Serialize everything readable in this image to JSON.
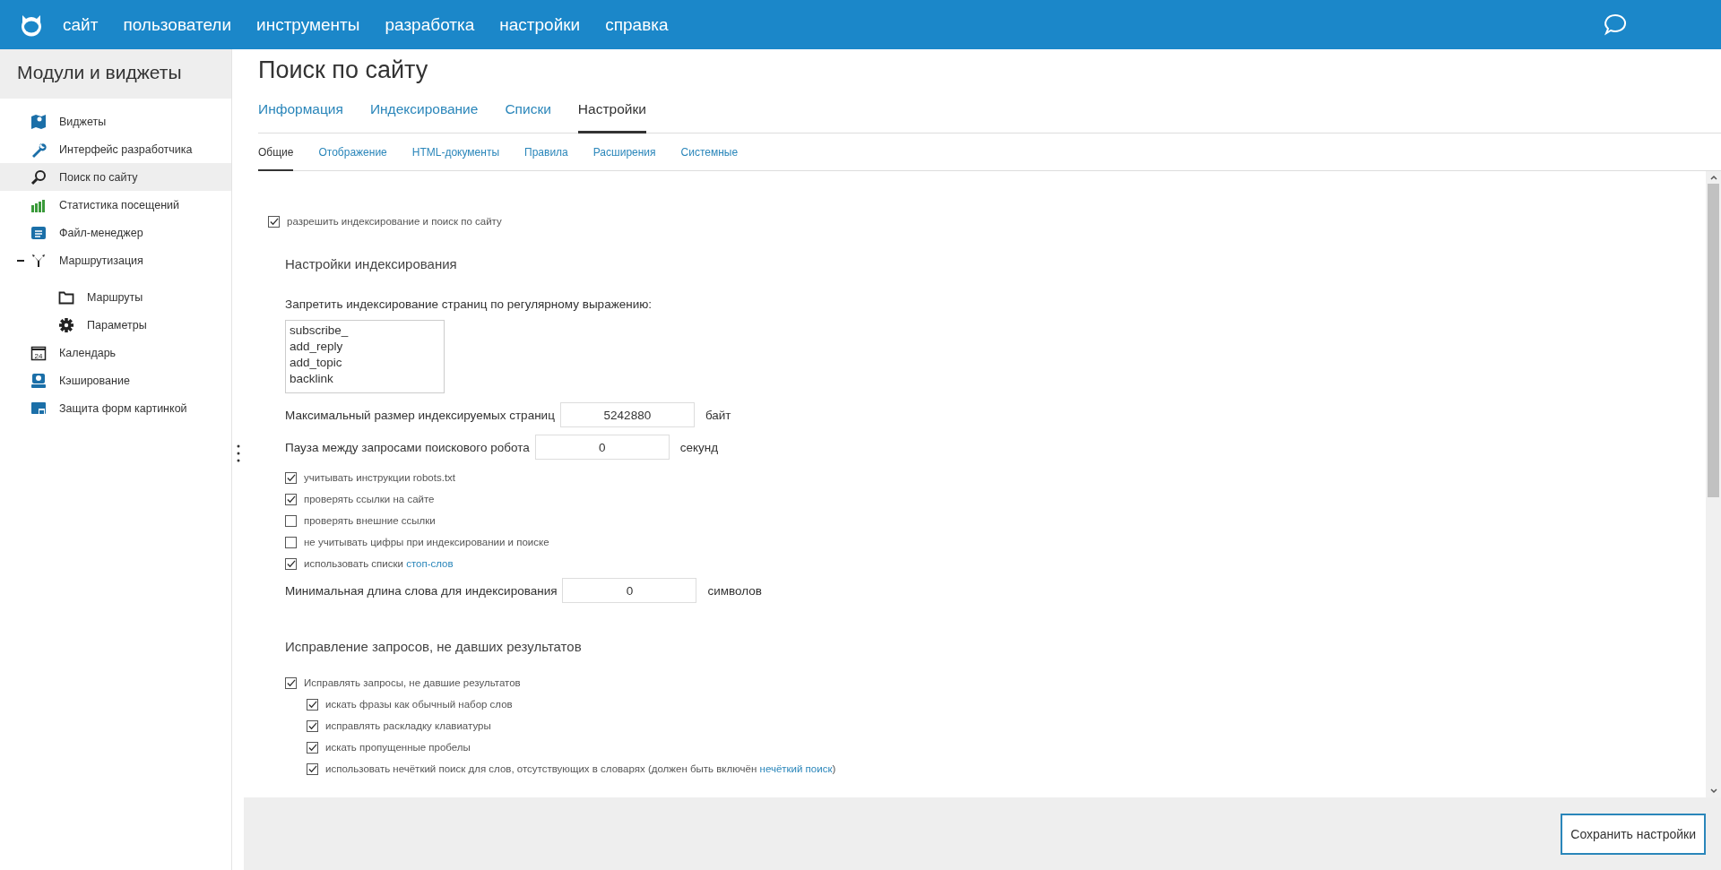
{
  "topbar": {
    "nav": [
      "сайт",
      "пользователи",
      "инструменты",
      "разработка",
      "настройки",
      "справка"
    ]
  },
  "sidebar": {
    "title": "Модули и виджеты",
    "items": [
      {
        "label": "Виджеты",
        "selected": false
      },
      {
        "label": "Интерфейс разработчика",
        "selected": false
      },
      {
        "label": "Поиск по сайту",
        "selected": true
      },
      {
        "label": "Статистика посещений",
        "selected": false
      },
      {
        "label": "Файл-менеджер",
        "selected": false
      },
      {
        "label": "Маршрутизация",
        "selected": false,
        "expanded": true,
        "children": [
          {
            "label": "Маршруты",
            "selected": false
          },
          {
            "label": "Параметры",
            "selected": false
          }
        ]
      },
      {
        "label": "Календарь",
        "selected": false,
        "icon_text": "24"
      },
      {
        "label": "Кэширование",
        "selected": false
      },
      {
        "label": "Защита форм картинкой",
        "selected": false
      }
    ]
  },
  "page": {
    "title": "Поиск по сайту",
    "tabs": [
      {
        "label": "Информация",
        "selected": false
      },
      {
        "label": "Индексирование",
        "selected": false
      },
      {
        "label": "Списки",
        "selected": false
      },
      {
        "label": "Настройки",
        "selected": true
      }
    ],
    "subtabs": [
      {
        "label": "Общие",
        "selected": true
      },
      {
        "label": "Отображение",
        "selected": false
      },
      {
        "label": "HTML-документы",
        "selected": false
      },
      {
        "label": "Правила",
        "selected": false
      },
      {
        "label": "Расширения",
        "selected": false
      },
      {
        "label": "Системные",
        "selected": false
      }
    ],
    "enable": {
      "text": "разрешить индексирование и поиск по сайту",
      "checked": true
    },
    "indexing": {
      "heading": "Настройки индексирования",
      "regex_label": "Запретить индексирование страниц по регулярному выражению:",
      "regex_lines": [
        "subscribe_",
        "add_reply",
        "add_topic",
        "backlink"
      ],
      "fields1": [
        {
          "label": "Максимальный размер индексируемых страниц",
          "value": "5242880",
          "unit": "байт"
        },
        {
          "label": "Пауза между запросами поискового робота",
          "value": "0",
          "unit": "секунд"
        }
      ],
      "options": [
        {
          "text": "учитывать инструкции robots.txt",
          "checked": true
        },
        {
          "text": "проверять ссылки на сайте",
          "checked": true
        },
        {
          "text": "проверять внешние ссылки",
          "checked": false
        },
        {
          "text": "не учитывать цифры при индексировании и поиске",
          "checked": false
        },
        {
          "text": "использовать списки ",
          "link": "стоп-слов",
          "checked": true
        }
      ],
      "fields2": [
        {
          "label": "Минимальная длина слова для индексирования",
          "value": "0",
          "unit": "символов"
        }
      ]
    },
    "correction": {
      "heading": "Исправление запросов, не давших результатов",
      "main": {
        "text": "Исправлять запросы, не давшие результатов",
        "checked": true
      },
      "options": [
        {
          "text": "искать фразы как обычный набор слов",
          "checked": true
        },
        {
          "text": "исправлять раскладку клавиатуры",
          "checked": true
        },
        {
          "text": "искать пропущенные пробелы",
          "checked": true
        },
        {
          "text": "использовать нечёткий поиск для слов, отсутствующих в словарях (должен быть включён ",
          "link": "нечёткий поиск",
          "after": ")",
          "checked": true
        }
      ]
    },
    "save_button": "Сохранить настройки"
  }
}
